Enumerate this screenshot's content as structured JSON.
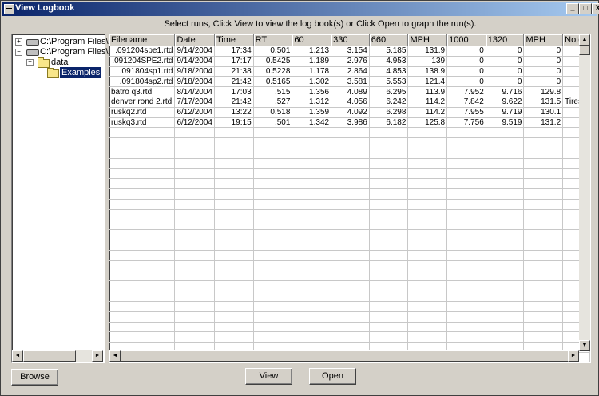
{
  "window": {
    "title": "View Logbook",
    "minimize": "_",
    "maximize": "□",
    "close": "X"
  },
  "instruction": "Select runs, Click View to view the log book(s) or Click Open to graph the run(s).",
  "tree": {
    "nodes": [
      {
        "expander": "+",
        "icon": "drive",
        "label": "C:\\Program Files\\RPM"
      },
      {
        "expander": "−",
        "icon": "drive",
        "label": "C:\\Program Files\\RPM"
      },
      {
        "expander": "−",
        "icon": "folder",
        "label": "data"
      },
      {
        "expander": "",
        "icon": "folder-open",
        "label": "Examples"
      }
    ]
  },
  "grid": {
    "columns": [
      "Filename",
      "Date",
      "Time",
      "RT",
      "60",
      "330",
      "660",
      "MPH",
      "1000",
      "1320",
      "MPH",
      "Notes"
    ],
    "rows": [
      [
        ".091204spe1.rtd",
        "9/14/2004",
        "17:34",
        "0.501",
        "1.213",
        "3.154",
        "5.185",
        "131.9",
        "0",
        "0",
        "0",
        ""
      ],
      [
        ".091204SPE2.rtd",
        "9/14/2004",
        "17:17",
        "0.5425",
        "1.189",
        "2.976",
        "4.953",
        "139",
        "0",
        "0",
        "0",
        ""
      ],
      [
        ".091804sp1.rtd",
        "9/18/2004",
        "21:38",
        "0.5228",
        "1.178",
        "2.864",
        "4.853",
        "138.9",
        "0",
        "0",
        "0",
        ""
      ],
      [
        ".091804sp2.rtd",
        "9/18/2004",
        "21:42",
        "0.5165",
        "1.302",
        "3.581",
        "5.553",
        "121.4",
        "0",
        "0",
        "0",
        ""
      ],
      [
        "batro q3.rtd",
        "8/14/2004",
        "17:03",
        ".515",
        "1.356",
        "4.089",
        "6.295",
        "113.9",
        "7.952",
        "9.716",
        "129.8",
        ""
      ],
      [
        "denver rond 2.rtd",
        "7/17/2004",
        "21:42",
        ".527",
        "1.312",
        "4.056",
        "6.242",
        "114.2",
        "7.842",
        "9.622",
        "131.5",
        "Tires"
      ],
      [
        "ruskq2.rtd",
        "6/12/2004",
        "13:22",
        "0.518",
        "1.359",
        "4.092",
        "6.298",
        "114.2",
        "7.955",
        "9.719",
        "130.1",
        ""
      ],
      [
        "ruskq3.rtd",
        "6/12/2004",
        "19:15",
        ".501",
        "1.342",
        "3.986",
        "6.182",
        "125.8",
        "7.756",
        "9.519",
        "131.2",
        ""
      ]
    ],
    "empty_rows": 23
  },
  "buttons": {
    "browse": "Browse",
    "view": "View",
    "open": "Open"
  },
  "scroll": {
    "left": "◄",
    "right": "►",
    "up": "▲",
    "down": "▼"
  }
}
